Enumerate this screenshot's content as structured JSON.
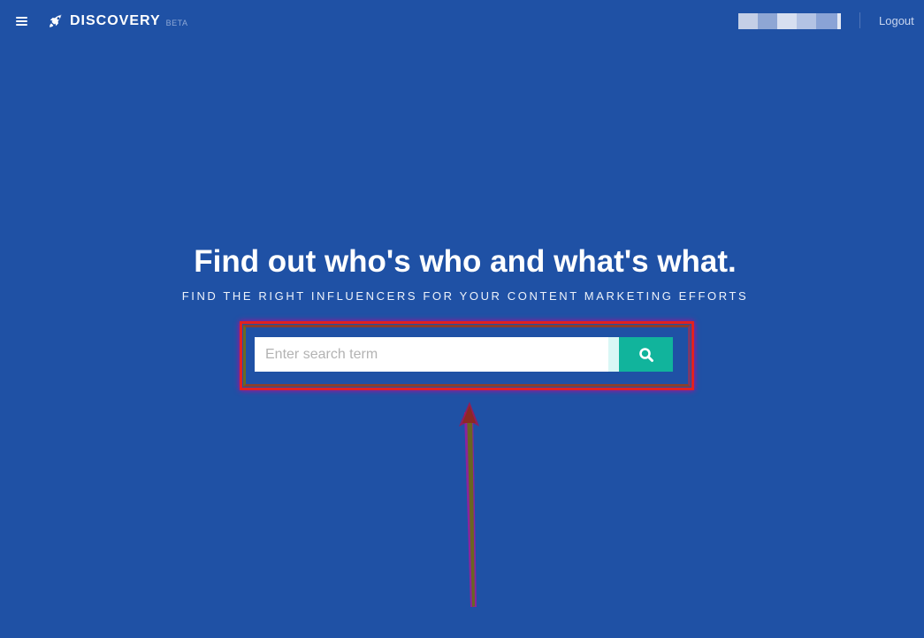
{
  "header": {
    "brand_name": "DISCOVERY",
    "brand_badge": "BETA",
    "logout_label": "Logout",
    "icons": {
      "menu": "hamburger-menu-icon",
      "brand": "rocket-icon"
    }
  },
  "hero": {
    "title": "Find out who's who and what's what.",
    "subtitle": "FIND THE RIGHT INFLUENCERS FOR YOUR CONTENT MARKETING EFFORTS"
  },
  "search": {
    "placeholder": "Enter search term",
    "value": "",
    "button_icon": "search-icon"
  },
  "colors": {
    "background": "#1f51a5",
    "accent": "#11b49c",
    "annotation_red": "#e3211f",
    "annotation_magenta": "#c80096",
    "annotation_olive": "#6b6a1e"
  }
}
